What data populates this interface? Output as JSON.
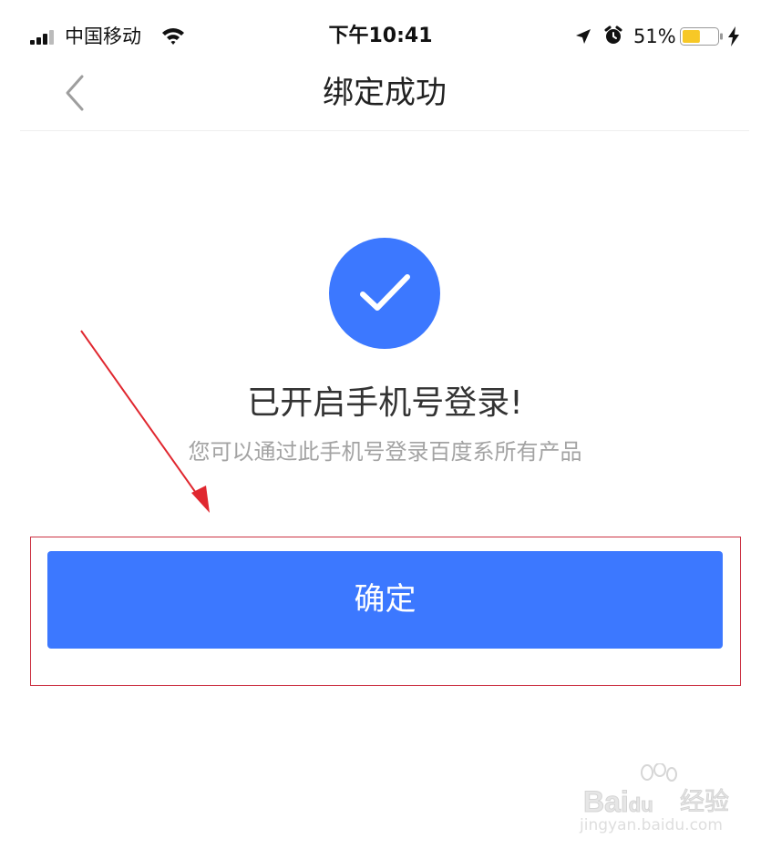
{
  "status_bar": {
    "carrier": "中国移动",
    "time": "下午10:41",
    "battery_percent": "51%",
    "battery_level": 0.51,
    "icons": [
      "signal-icon",
      "wifi-icon",
      "location-arrow-icon",
      "alarm-icon",
      "battery-icon",
      "charging-bolt-icon"
    ]
  },
  "nav": {
    "back_icon": "chevron-left-icon",
    "title": "绑定成功"
  },
  "success": {
    "icon": "check-circle-icon",
    "title": "已开启手机号登录!",
    "subtitle": "您可以通过此手机号登录百度系所有产品"
  },
  "actions": {
    "confirm_label": "确定"
  },
  "annotations": {
    "arrow_color": "#e0272f",
    "box_color": "#cc3344"
  },
  "watermark": {
    "brand": "Bai",
    "brand_mark": "du",
    "product": "经验",
    "url": "jingyan.baidu.com"
  },
  "colors": {
    "accent": "#3c78ff",
    "title_text": "#333333",
    "subtitle_text": "#a3a3a3"
  }
}
